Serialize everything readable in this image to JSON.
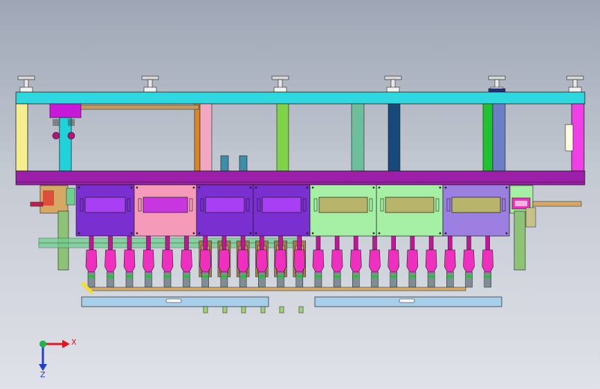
{
  "axes": {
    "x_label": "X",
    "z_label": "Z",
    "x_color": "#e0141e",
    "z_color": "#1e3cd2",
    "origin_color": "#22b24c"
  },
  "colors": {
    "frame_beam": "#2fd8df",
    "base_beam": "#9b1fa8",
    "frame_edge": "#1a1a1a",
    "left_post": "#f3ef8f",
    "right_post": "#ef3fe6",
    "nozzle": "#ef2fbd",
    "nozzle_dark": "#c21597",
    "rail": "#a8cfe9",
    "pipe": "#d6a865"
  },
  "columns": [
    {
      "color": "#21d3d9"
    },
    {
      "color": "#d9862a"
    },
    {
      "color": "#f2a7c3"
    },
    {
      "color": "#7fd24a"
    },
    {
      "color": "#6cbf9a"
    },
    {
      "color": "#154a7a"
    },
    {
      "color": "#23c132"
    },
    {
      "color": "#6b7fc4"
    }
  ],
  "modules": [
    {
      "color": "#7a2fd1",
      "window": "#a640f2"
    },
    {
      "color": "#f59ab8",
      "window": "#c836e0"
    },
    {
      "color": "#7a2fd1",
      "window": "#a640f2"
    },
    {
      "color": "#7a2fd1",
      "window": "#a640f2"
    },
    {
      "color": "#a5f0a5",
      "window": "#b7b56a"
    },
    {
      "color": "#a5f0a5",
      "window": "#b7b56a"
    },
    {
      "color": "#9c7fe0",
      "window": "#b7b56a"
    }
  ],
  "nozzle_count": 22
}
